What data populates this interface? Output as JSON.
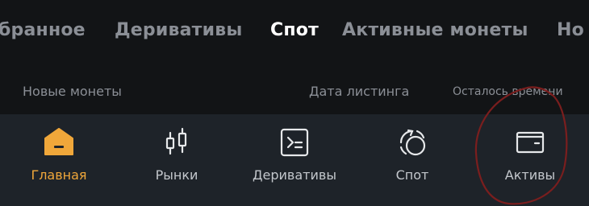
{
  "tabs": {
    "items": [
      {
        "label": "бранное"
      },
      {
        "label": "Деривативы"
      },
      {
        "label": "Спот"
      },
      {
        "label": "Активные монеты"
      },
      {
        "label": "Но"
      }
    ],
    "active": "Спот"
  },
  "list_header": {
    "new_coins": "Новые монеты",
    "listing_date": "Дата листинга",
    "time_left": "Осталось времени"
  },
  "bottom_nav": {
    "items": [
      {
        "label": "Главная",
        "icon": "home-icon"
      },
      {
        "label": "Рынки",
        "icon": "candlestick-icon"
      },
      {
        "label": "Деривативы",
        "icon": "futures-icon"
      },
      {
        "label": "Спот",
        "icon": "spot-icon"
      },
      {
        "label": "Активы",
        "icon": "wallet-icon"
      }
    ],
    "active": "Главная"
  },
  "colors": {
    "accent": "#f0a73a",
    "background": "#16181b",
    "nav_background": "#1e2329",
    "annotation": "#7a1e1e"
  }
}
